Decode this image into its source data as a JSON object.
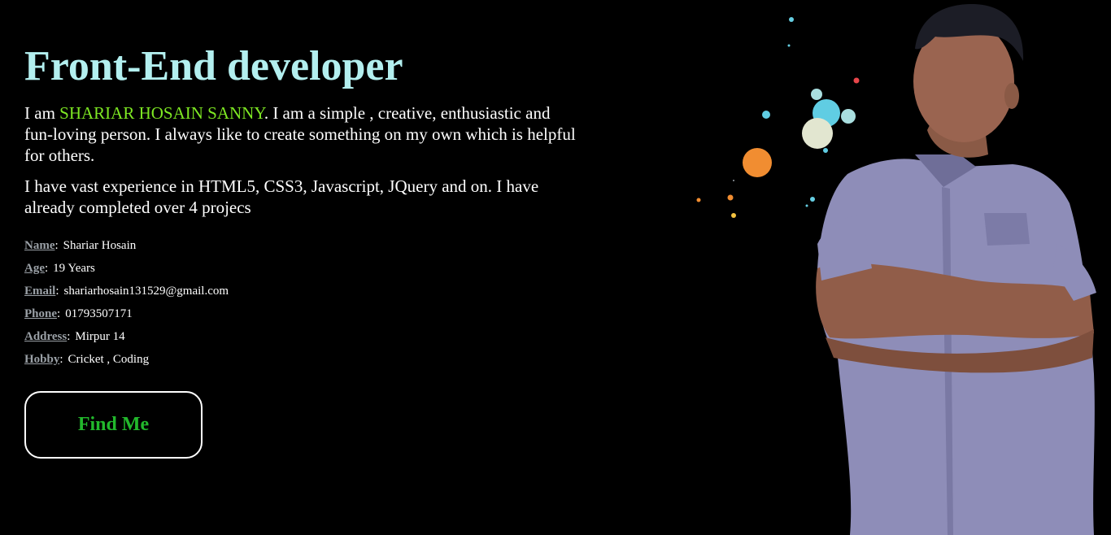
{
  "hero": {
    "title": "Front-End developer",
    "intro_prefix": "I am ",
    "intro_name": "SHARIAR HOSAIN SANNY",
    "intro_suffix": ". I am a simple , creative, enthusiastic and fun-loving person. I always like to create something on my own which is helpful for others.",
    "experience": "I have vast experience in HTML5, CSS3, Javascript, JQuery and on. I have already completed over 4 projecs"
  },
  "info": [
    {
      "label": "Name",
      "value": "Shariar Hosain"
    },
    {
      "label": "Age",
      "value": "19 Years"
    },
    {
      "label": "Email",
      "value": "shariarhosain131529@gmail.com"
    },
    {
      "label": "Phone",
      "value": "01793507171"
    },
    {
      "label": "Address",
      "value": "Mirpur 14"
    },
    {
      "label": "Hobby",
      "value": "Cricket , Coding"
    }
  ],
  "colon": ":",
  "cta": {
    "label": "Find Me"
  },
  "colors": {
    "background": "#000000",
    "headline": "#b3efef",
    "name_highlight": "#7ee823",
    "button_text": "#22b82c",
    "label": "#9aa0a6"
  }
}
